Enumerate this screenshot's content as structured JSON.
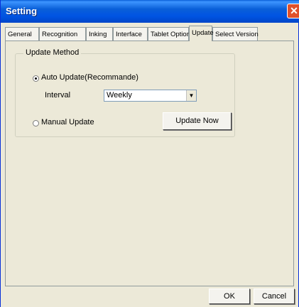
{
  "window": {
    "title": "Setting",
    "close_icon": "close-icon"
  },
  "tabs": [
    {
      "label": "General"
    },
    {
      "label": "Recognition"
    },
    {
      "label": "Inking"
    },
    {
      "label": "Interface"
    },
    {
      "label": "Tablet Options"
    },
    {
      "label": "Update",
      "selected": true
    },
    {
      "label": "Select Version"
    }
  ],
  "update_method": {
    "group_label": "Update Method",
    "auto_update": {
      "label": "Auto Update(Recommande)",
      "checked": true
    },
    "interval": {
      "label": "Interval",
      "value": "Weekly"
    },
    "manual_update": {
      "label": "Manual Update",
      "checked": false
    },
    "update_now_label": "Update Now"
  },
  "footer": {
    "ok_label": "OK",
    "cancel_label": "Cancel"
  }
}
